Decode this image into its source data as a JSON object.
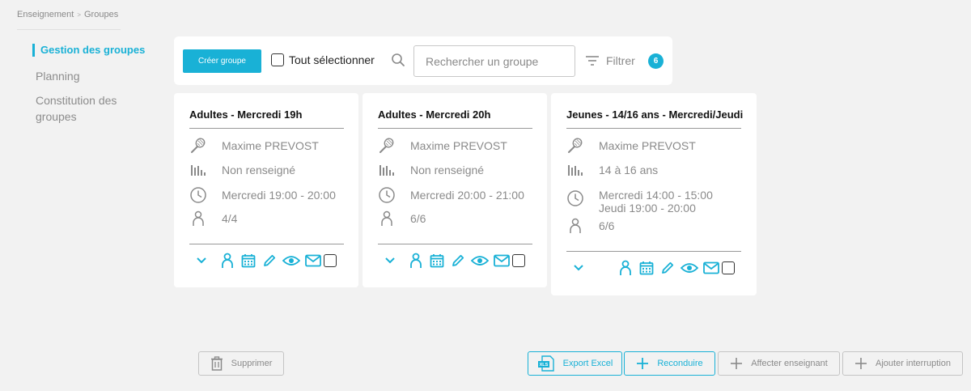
{
  "breadcrumb": {
    "root": "Enseignement",
    "separator": ">",
    "current": "Groupes"
  },
  "sidebar": {
    "items": [
      {
        "label": "Gestion des groupes",
        "active": true
      },
      {
        "label": "Planning",
        "active": false
      },
      {
        "label": "Constitution des groupes",
        "active": false
      }
    ]
  },
  "toolbar": {
    "create_label": "Créer groupe",
    "select_all_label": "Tout sélectionner",
    "search_placeholder": "Rechercher un groupe",
    "filter_label": "Filtrer",
    "filter_count": "6"
  },
  "cards": [
    {
      "title": "Adultes - Mercredi 19h",
      "teacher": "Maxime PREVOST",
      "level": "Non renseigné",
      "schedule_1": "Mercredi 19:00 - 20:00",
      "schedule_2": "",
      "members": "4/4"
    },
    {
      "title": "Adultes - Mercredi 20h",
      "teacher": "Maxime PREVOST",
      "level": "Non renseigné",
      "schedule_1": "Mercredi 20:00 - 21:00",
      "schedule_2": "",
      "members": "6/6"
    },
    {
      "title": "Jeunes - 14/16 ans - Mercredi/Jeudi",
      "teacher": "Maxime PREVOST",
      "level": "14 à 16 ans",
      "schedule_1": "Mercredi 14:00 - 15:00",
      "schedule_2": "Jeudi 19:00 - 20:00",
      "members": "6/6"
    }
  ],
  "footer": {
    "delete_label": "Supprimer",
    "export_label": "Export Excel",
    "renew_label": "Reconduire",
    "assign_teacher_label": "Affecter enseignant",
    "add_interruption_label": "Ajouter interruption"
  },
  "colors": {
    "accent": "#19b1d6",
    "background": "#f2f2f2",
    "card": "#ffffff",
    "muted_text": "#8a8a8a"
  }
}
